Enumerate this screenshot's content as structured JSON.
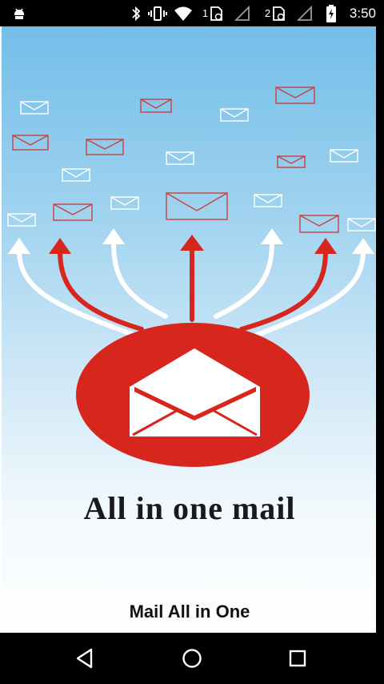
{
  "status_bar": {
    "time": "3:50",
    "sim1_label": "1",
    "sim2_label": "2",
    "icons": [
      "android-debug-icon",
      "bluetooth-icon",
      "vibrate-icon",
      "wifi-icon",
      "sim-1-icon",
      "signal-1-icon",
      "sim-2-icon",
      "signal-2-icon",
      "battery-charging-icon"
    ]
  },
  "splash": {
    "headline": "All in one mail",
    "app_name": "Mail All in One",
    "colors": {
      "sky_top": "#73bee9",
      "sky_bottom": "#ffffff",
      "accent_red": "#d7261e",
      "envelope_white": "#ffffff"
    },
    "icons": [
      "open-envelope-icon",
      "floating-envelope-icon",
      "arrow-up-icon"
    ]
  },
  "nav_bar": {
    "icons": [
      "back-icon",
      "home-icon",
      "recents-icon"
    ]
  }
}
